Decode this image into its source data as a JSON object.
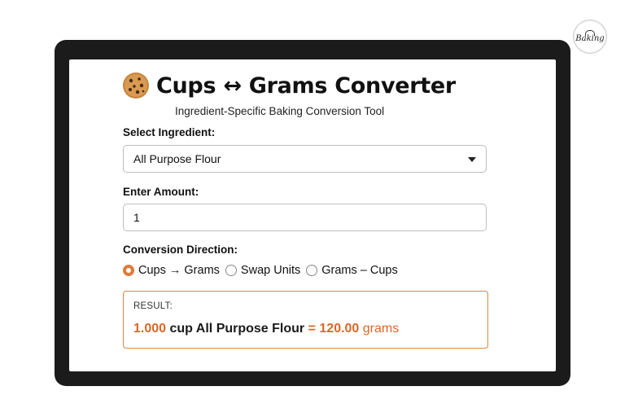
{
  "app": {
    "title": "Cups ↔ Grams Converter",
    "subtitle": "Ingredient-Specific Baking Conversion Tool",
    "icon": "cookie-icon"
  },
  "watermark": {
    "text": "Baking"
  },
  "form": {
    "ingredient_label": "Select Ingredient:",
    "ingredient_value": "All Purpose Flour",
    "amount_label": "Enter Amount:",
    "amount_value": "1",
    "direction_label": "Conversion Direction:",
    "direction_options": [
      {
        "label": "Cups → Grams",
        "selected": true
      },
      {
        "label": "Swap Units",
        "selected": false
      },
      {
        "label": "Grams – Cups",
        "selected": false
      }
    ]
  },
  "result": {
    "label": "RESULT:",
    "amount": "1.000",
    "unit_text": "cup All Purpose Flour",
    "equals": "=",
    "grams_value": "120.00",
    "grams_unit": "grams"
  },
  "colors": {
    "accent": "#d9672a",
    "device_frame": "#1b1b1b"
  }
}
